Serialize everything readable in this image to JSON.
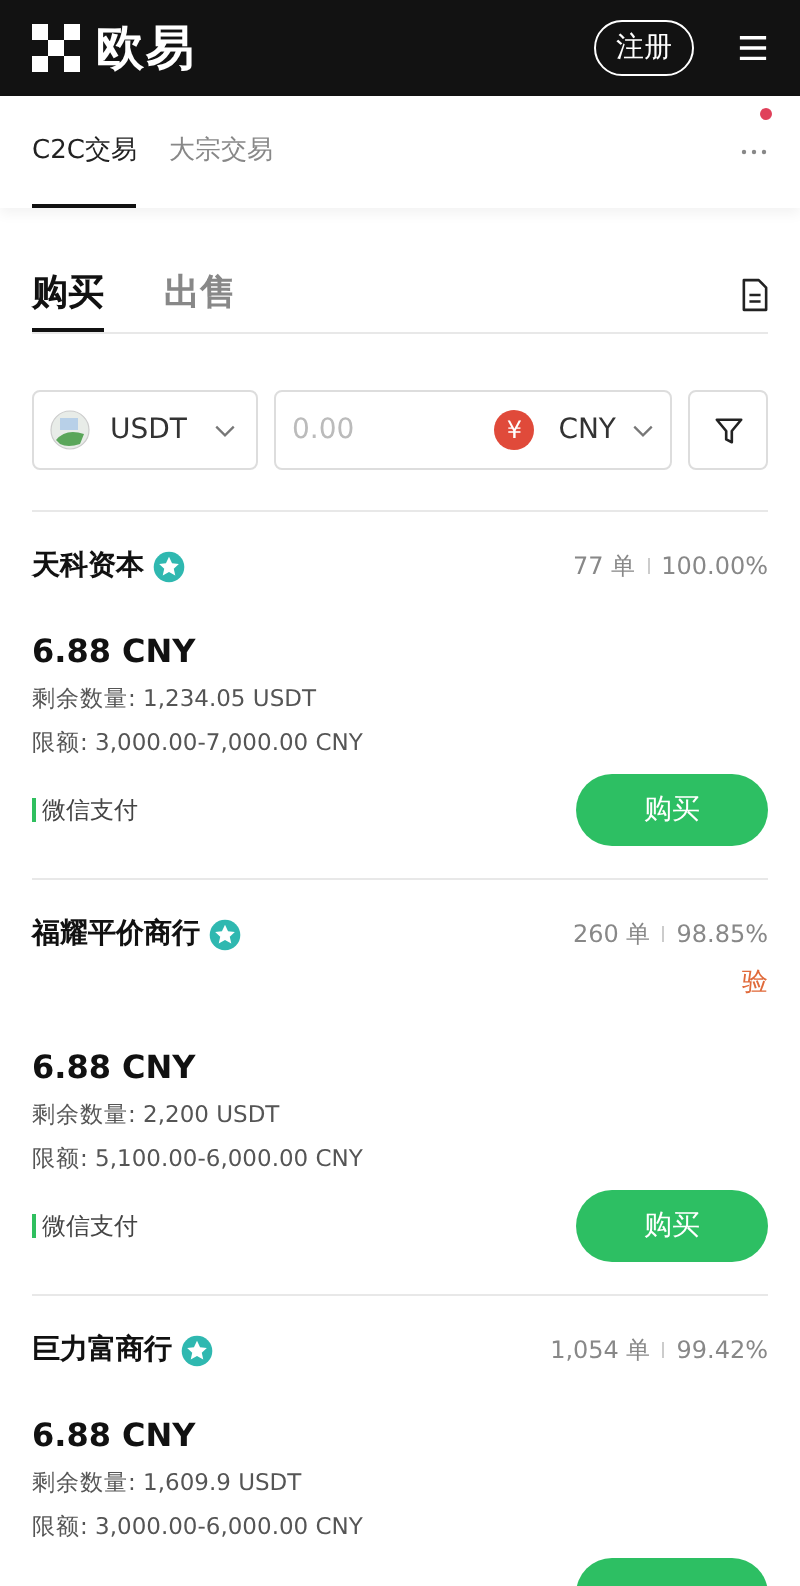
{
  "header": {
    "logo_text": "欧易",
    "signup_button": "注册"
  },
  "subnav": {
    "tabs": [
      {
        "label": "C2C交易",
        "selected": true
      },
      {
        "label": "大宗交易",
        "selected": false
      }
    ],
    "notification_dot": true
  },
  "trade_tabs": [
    {
      "label": "购买",
      "selected": true
    },
    {
      "label": "出售",
      "selected": false
    }
  ],
  "filters": {
    "crypto": "USDT",
    "amount_placeholder": "0.00",
    "currency_symbol": "¥",
    "currency": "CNY"
  },
  "offers": [
    {
      "merchant": "天科资本",
      "verified": true,
      "orders": "77 单",
      "completion": "100.00%",
      "price": "6.88 CNY",
      "available": "剩余数量: 1,234.05 USDT",
      "limits": "限额: 3,000.00-7,000.00 CNY",
      "payment": "微信支付",
      "button": "购买"
    },
    {
      "merchant": "福耀平价商行",
      "verified": true,
      "orders": "260 单",
      "completion": "98.85%",
      "note": "验",
      "price": "6.88 CNY",
      "available": "剩余数量: 2,200 USDT",
      "limits": "限额: 5,100.00-6,000.00 CNY",
      "payment": "微信支付",
      "button": "购买"
    },
    {
      "merchant": "巨力富商行",
      "verified": true,
      "orders": "1,054 单",
      "completion": "99.42%",
      "price": "6.88 CNY",
      "available": "剩余数量: 1,609.9 USDT",
      "limits": "限额: 3,000.00-6,000.00 CNY"
    }
  ]
}
